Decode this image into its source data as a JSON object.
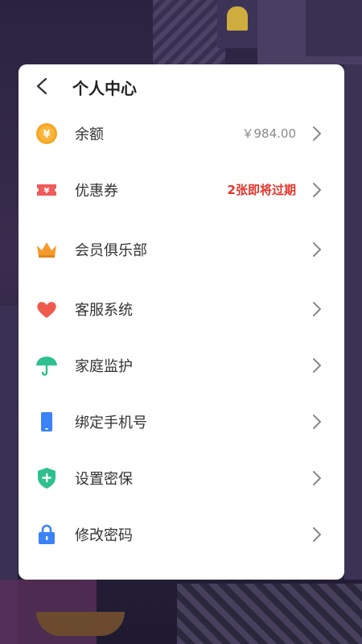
{
  "header": {
    "title": "个人中心"
  },
  "rows": [
    {
      "label": "余额",
      "value": "￥984.00",
      "icon": "coin-icon"
    },
    {
      "label": "优惠券",
      "value": "2张即将过期",
      "icon": "coupon-icon"
    },
    {
      "label": "会员俱乐部",
      "value": "",
      "icon": "crown-icon"
    },
    {
      "label": "客服系统",
      "value": "",
      "icon": "heart-icon"
    },
    {
      "label": "家庭监护",
      "value": "",
      "icon": "umbrella-icon"
    },
    {
      "label": "绑定手机号",
      "value": "",
      "icon": "phone-icon"
    },
    {
      "label": "设置密保",
      "value": "",
      "icon": "shield-icon"
    },
    {
      "label": "修改密码",
      "value": "",
      "icon": "lock-icon"
    }
  ],
  "colors": {
    "coin": "#f5a623",
    "coupon": "#f05b5b",
    "crown": "#f59b2b",
    "heart": "#ef5a4f",
    "umbrella": "#2ec08d",
    "phone": "#3b82f6",
    "shield": "#2ec08d",
    "lock": "#3b82f6",
    "warn": "#e8332a"
  }
}
